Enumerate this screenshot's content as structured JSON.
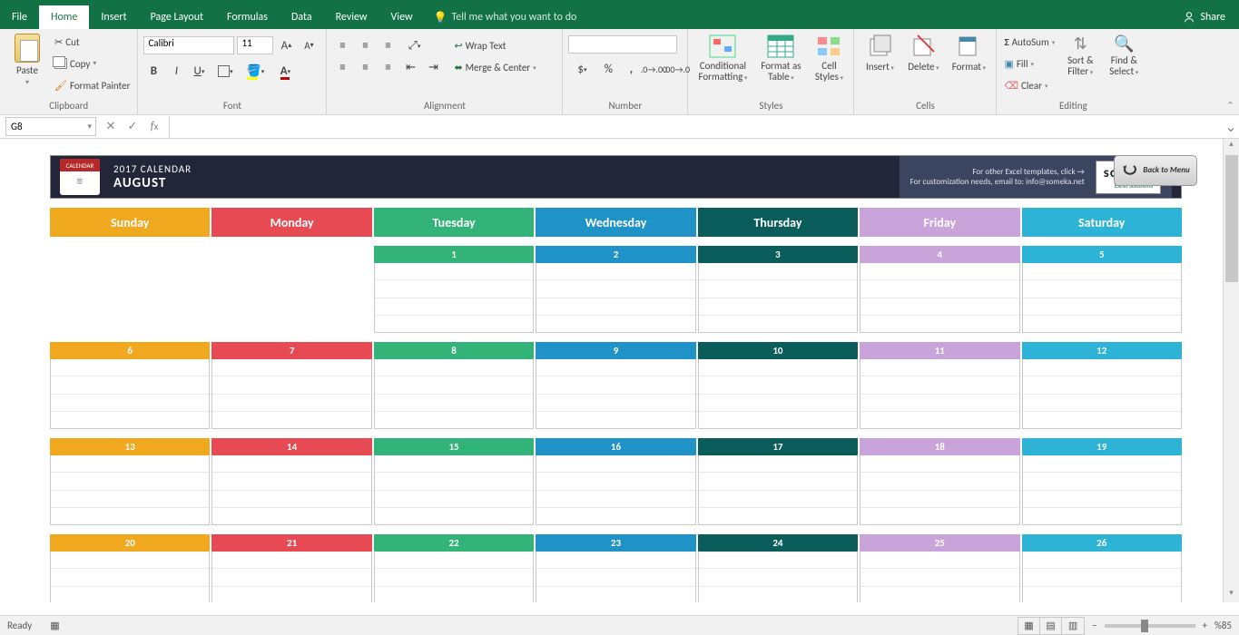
{
  "menu": {
    "items": [
      "File",
      "Home",
      "Insert",
      "Page Layout",
      "Formulas",
      "Data",
      "Review",
      "View"
    ],
    "active": "Home",
    "tell_me": "Tell me what you want to do",
    "share": "Share"
  },
  "ribbon": {
    "clipboard": {
      "label": "Clipboard",
      "paste": "Paste",
      "cut": "Cut",
      "copy": "Copy",
      "painter": "Format Painter"
    },
    "font": {
      "label": "Font",
      "family": "Calibri",
      "size": "11"
    },
    "alignment": {
      "label": "Alignment",
      "wrap": "Wrap Text",
      "merge": "Merge & Center"
    },
    "number": {
      "label": "Number"
    },
    "styles": {
      "label": "Styles",
      "cond": "Conditional Formatting",
      "table": "Format as Table",
      "cell": "Cell Styles"
    },
    "cells": {
      "label": "Cells",
      "insert": "Insert",
      "delete": "Delete",
      "format": "Format"
    },
    "editing": {
      "label": "Editing",
      "autosum": "AutoSum",
      "fill": "Fill",
      "clear": "Clear",
      "sort": "Sort & Filter",
      "find": "Find & Select"
    }
  },
  "formula": {
    "cell": "G8"
  },
  "calendar": {
    "year": "2017 CALENDAR",
    "month": "AUGUST",
    "other_templates": "For other Excel templates, click →",
    "email": "For customization needs, email to: info@someka.net",
    "logo": "someka",
    "logo_sub": "Excel Solutions",
    "back": "Back to Menu",
    "days": [
      "Sunday",
      "Monday",
      "Tuesday",
      "Wednesday",
      "Thursday",
      "Friday",
      "Saturday"
    ],
    "colors": [
      "#f0a81e",
      "#e84a54",
      "#32b378",
      "#1f92c7",
      "#0b5d5c",
      "#c8a4da",
      "#2cb3d6"
    ],
    "weeks": [
      [
        null,
        null,
        1,
        2,
        3,
        4,
        5
      ],
      [
        6,
        7,
        8,
        9,
        10,
        11,
        12
      ],
      [
        13,
        14,
        15,
        16,
        17,
        18,
        19
      ],
      [
        20,
        21,
        22,
        23,
        24,
        25,
        26
      ]
    ]
  },
  "status": {
    "ready": "Ready",
    "zoom": "%85"
  }
}
